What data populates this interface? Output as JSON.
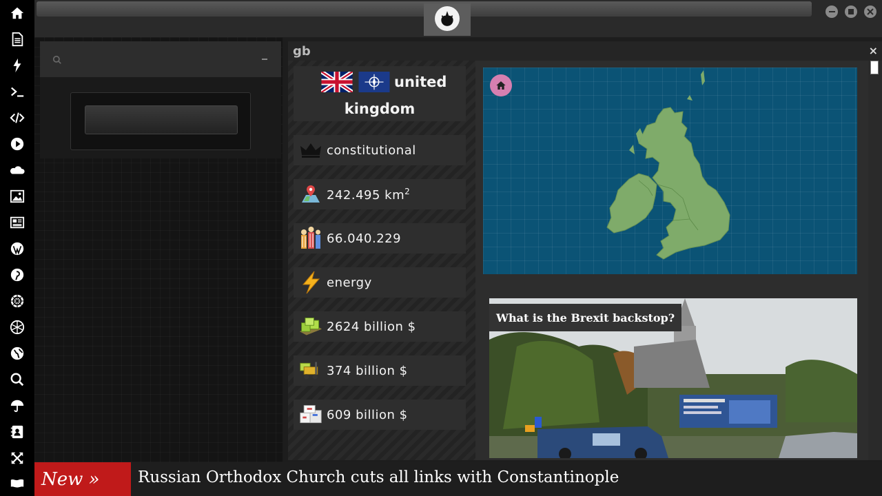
{
  "sidebar": {
    "items": [
      {
        "icon": "home-icon"
      },
      {
        "icon": "document-icon"
      },
      {
        "icon": "lightning-icon"
      },
      {
        "icon": "terminal-icon"
      },
      {
        "icon": "code-icon"
      },
      {
        "icon": "play-icon"
      },
      {
        "icon": "cloud-icon"
      },
      {
        "icon": "image-icon"
      },
      {
        "icon": "newspaper-icon"
      },
      {
        "icon": "wordpress-icon"
      },
      {
        "icon": "pinterest-icon"
      },
      {
        "icon": "settings-wheel-icon"
      },
      {
        "icon": "globe-grid-icon"
      },
      {
        "icon": "globe-icon"
      },
      {
        "icon": "search-icon"
      },
      {
        "icon": "umbrella-icon"
      },
      {
        "icon": "contact-icon"
      },
      {
        "icon": "expand-icon"
      },
      {
        "icon": "flag-icon"
      }
    ]
  },
  "topbar": {
    "logo_icon": "rebel-alliance-icon"
  },
  "window": {
    "title": "gb",
    "close_label": "×",
    "country": {
      "name_line1": "united",
      "name_line2": "kingdom",
      "flags": [
        "uk-flag-icon",
        "nato-flag-icon"
      ]
    },
    "stats": [
      {
        "icon": "crown-icon",
        "text": "constitutional"
      },
      {
        "icon": "map-pin-icon",
        "text": "242.495 km",
        "sup": "2"
      },
      {
        "icon": "population-icon",
        "text": "66.040.229"
      },
      {
        "icon": "energy-icon",
        "text": "energy"
      },
      {
        "icon": "cash-icon",
        "text": "2624 billion $"
      },
      {
        "icon": "forklift-icon",
        "text": "374 billion $"
      },
      {
        "icon": "packages-icon",
        "text": "609 billion $"
      }
    ],
    "news": {
      "caption": "What is the Brexit backstop?"
    }
  },
  "ticker": {
    "label": "New »",
    "headline": "Russian Orthodox Church cuts all links with Constantinople"
  },
  "colors": {
    "ticker_red": "#c01a1a",
    "map_blue": "#0b5375",
    "land_green": "#7fab6a",
    "home_pink": "#d67fb0"
  }
}
